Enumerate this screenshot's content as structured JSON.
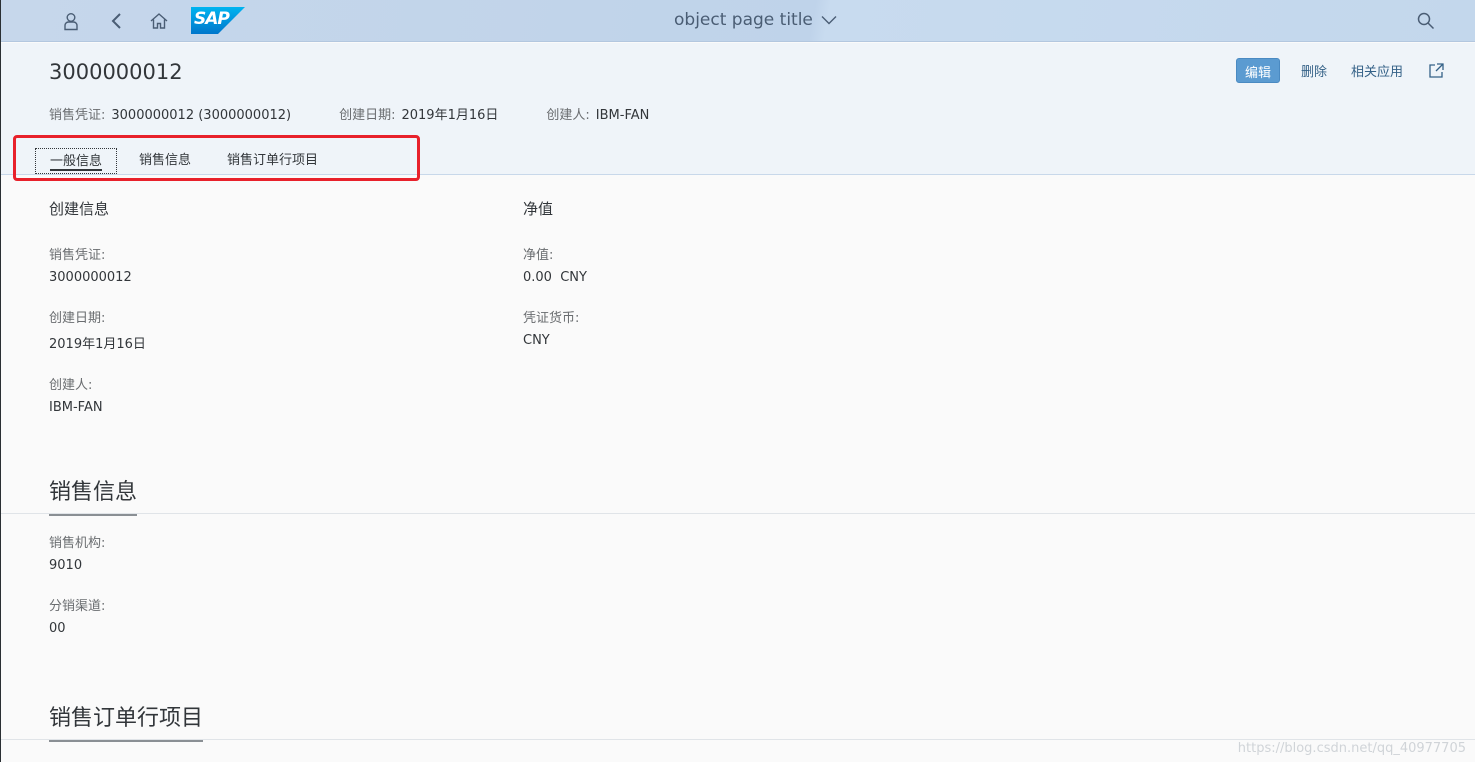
{
  "shell": {
    "title": "object page title",
    "logo_text": "SAP",
    "icons": [
      "user-icon",
      "back-icon",
      "home-icon",
      "search-icon"
    ]
  },
  "header": {
    "object_title": "3000000012",
    "actions": {
      "edit": "编辑",
      "delete": "删除",
      "related_apps": "相关应用"
    },
    "attributes": [
      {
        "label": "销售凭证:",
        "value": "3000000012 (3000000012)"
      },
      {
        "label": "创建日期:",
        "value": "2019年1月16日"
      },
      {
        "label": "创建人:",
        "value": "IBM-FAN"
      }
    ]
  },
  "anchors": [
    {
      "label": "一般信息",
      "active": true
    },
    {
      "label": "销售信息",
      "active": false
    },
    {
      "label": "销售订单行项目",
      "active": false
    }
  ],
  "general": {
    "create_info": {
      "title": "创建信息",
      "fields": [
        {
          "label": "销售凭证:",
          "value": "3000000012"
        },
        {
          "label": "创建日期:",
          "value": "2019年1月16日"
        },
        {
          "label": "创建人:",
          "value": "IBM-FAN"
        }
      ]
    },
    "net_value": {
      "title": "净值",
      "fields": [
        {
          "label": "净值:",
          "value": "0.00  CNY"
        },
        {
          "label": "凭证货币:",
          "value": "CNY"
        }
      ]
    }
  },
  "sales_section": {
    "title": "销售信息",
    "fields": [
      {
        "label": "销售机构:",
        "value": "9010"
      },
      {
        "label": "分销渠道:",
        "value": "00"
      }
    ]
  },
  "items_section": {
    "title": "销售订单行项目"
  },
  "watermark": "https://blog.csdn.net/qq_40977705",
  "colors": {
    "shell_bg": "#c3d7ec",
    "header_bg": "#eff4f9",
    "edit_button": "#5b9bd1",
    "link": "#346187",
    "highlight": "#e8212b"
  }
}
